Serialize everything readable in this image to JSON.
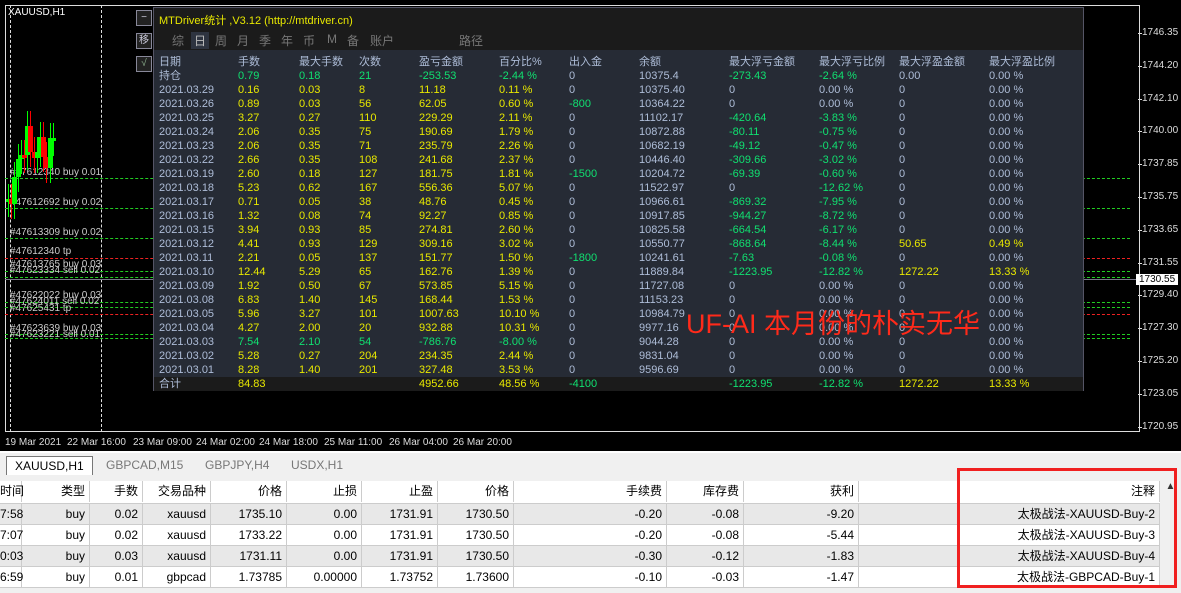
{
  "chart": {
    "symbol": "XAUUSD,H1",
    "current_price": "1730.55",
    "price_ticks": [
      "1746.35",
      "1744.20",
      "1742.10",
      "1740.00",
      "1737.85",
      "1735.75",
      "1733.65",
      "1731.55",
      "1729.40",
      "1727.30",
      "1725.20",
      "1723.05",
      "1720.95"
    ],
    "time_ticks": [
      "19 Mar 2021",
      "22 Mar 16:00",
      "23 Mar 09:00",
      "24 Mar 02:00",
      "24 Mar 18:00",
      "25 Mar 11:00",
      "26 Mar 04:00",
      "26 Mar 20:00"
    ],
    "orders": [
      "#47612340 buy 0.01",
      "#47612692 buy 0.02",
      "#47613309 buy 0.02",
      "#47612340 tp",
      "#47613765 buy 0.03",
      "#47623334 sell 0.02",
      "#47622022 buy 0.03",
      "#47624011 sell 0.02",
      "#47625431 tp",
      "#47623639 buy 0.03",
      "#47623221 sell 0.01"
    ],
    "side_buttons": [
      "−",
      "移",
      "√"
    ]
  },
  "panel": {
    "title": "MTDriver统计 ,V3.12 (http://mtdriver.cn)",
    "tabs": [
      "综",
      "日",
      "周",
      "月",
      "季",
      "年",
      "币",
      "M",
      "备",
      "账户",
      "路径"
    ],
    "headers": [
      "日期",
      "手数",
      "最大手数",
      "次数",
      "盈亏金额",
      "百分比%",
      "出入金",
      "余额",
      "最大浮亏金额",
      "最大浮亏比例",
      "最大浮盈金额",
      "最大浮盈比例"
    ],
    "rows": [
      [
        "持仓",
        "0.79",
        "0.18",
        "21",
        "-253.53",
        "-2.44 %",
        "0",
        "10375.4",
        "-273.43",
        "-2.64 %",
        "0.00",
        "0.00 %"
      ],
      [
        "2021.03.29",
        "0.16",
        "0.03",
        "8",
        "11.18",
        "0.11 %",
        "0",
        "10375.40",
        "0",
        "0.00 %",
        "0",
        "0.00 %"
      ],
      [
        "2021.03.26",
        "0.89",
        "0.03",
        "56",
        "62.05",
        "0.60 %",
        "-800",
        "10364.22",
        "0",
        "0.00 %",
        "0",
        "0.00 %"
      ],
      [
        "2021.03.25",
        "3.27",
        "0.27",
        "110",
        "229.29",
        "2.11 %",
        "0",
        "11102.17",
        "-420.64",
        "-3.83 %",
        "0",
        "0.00 %"
      ],
      [
        "2021.03.24",
        "2.06",
        "0.35",
        "75",
        "190.69",
        "1.79 %",
        "0",
        "10872.88",
        "-80.11",
        "-0.75 %",
        "0",
        "0.00 %"
      ],
      [
        "2021.03.23",
        "2.06",
        "0.35",
        "71",
        "235.79",
        "2.26 %",
        "0",
        "10682.19",
        "-49.12",
        "-0.47 %",
        "0",
        "0.00 %"
      ],
      [
        "2021.03.22",
        "2.66",
        "0.35",
        "108",
        "241.68",
        "2.37 %",
        "0",
        "10446.40",
        "-309.66",
        "-3.02 %",
        "0",
        "0.00 %"
      ],
      [
        "2021.03.19",
        "2.60",
        "0.18",
        "127",
        "181.75",
        "1.81 %",
        "-1500",
        "10204.72",
        "-69.39",
        "-0.60 %",
        "0",
        "0.00 %"
      ],
      [
        "2021.03.18",
        "5.23",
        "0.62",
        "167",
        "556.36",
        "5.07 %",
        "0",
        "11522.97",
        "0",
        "-12.62 %",
        "0",
        "0.00 %"
      ],
      [
        "2021.03.17",
        "0.71",
        "0.05",
        "38",
        "48.76",
        "0.45 %",
        "0",
        "10966.61",
        "-869.32",
        "-7.95 %",
        "0",
        "0.00 %"
      ],
      [
        "2021.03.16",
        "1.32",
        "0.08",
        "74",
        "92.27",
        "0.85 %",
        "0",
        "10917.85",
        "-944.27",
        "-8.72 %",
        "0",
        "0.00 %"
      ],
      [
        "2021.03.15",
        "3.94",
        "0.93",
        "85",
        "274.81",
        "2.60 %",
        "0",
        "10825.58",
        "-664.54",
        "-6.17 %",
        "0",
        "0.00 %"
      ],
      [
        "2021.03.12",
        "4.41",
        "0.93",
        "129",
        "309.16",
        "3.02 %",
        "0",
        "10550.77",
        "-868.64",
        "-8.44 %",
        "50.65",
        "0.49 %"
      ],
      [
        "2021.03.11",
        "2.21",
        "0.05",
        "137",
        "151.77",
        "1.50 %",
        "-1800",
        "10241.61",
        "-7.63",
        "-0.08 %",
        "0",
        "0.00 %"
      ],
      [
        "2021.03.10",
        "12.44",
        "5.29",
        "65",
        "162.76",
        "1.39 %",
        "0",
        "11889.84",
        "-1223.95",
        "-12.82 %",
        "1272.22",
        "13.33 %"
      ],
      [
        "2021.03.09",
        "1.92",
        "0.50",
        "67",
        "573.85",
        "5.15 %",
        "0",
        "11727.08",
        "0",
        "0.00 %",
        "0",
        "0.00 %"
      ],
      [
        "2021.03.08",
        "6.83",
        "1.40",
        "145",
        "168.44",
        "1.53 %",
        "0",
        "11153.23",
        "0",
        "0.00 %",
        "0",
        "0.00 %"
      ],
      [
        "2021.03.05",
        "5.96",
        "3.27",
        "101",
        "1007.63",
        "10.10 %",
        "0",
        "10984.79",
        "0",
        "0.00 %",
        "0",
        "0.00 %"
      ],
      [
        "2021.03.04",
        "4.27",
        "2.00",
        "20",
        "932.88",
        "10.31 %",
        "0",
        "9977.16",
        "0",
        "0.00 %",
        "0",
        "0.00 %"
      ],
      [
        "2021.03.03",
        "7.54",
        "2.10",
        "54",
        "-786.76",
        "-8.00 %",
        "0",
        "9044.28",
        "0",
        "0.00 %",
        "0",
        "0.00 %"
      ],
      [
        "2021.03.02",
        "5.28",
        "0.27",
        "204",
        "234.35",
        "2.44 %",
        "0",
        "9831.04",
        "0",
        "0.00 %",
        "0",
        "0.00 %"
      ],
      [
        "2021.03.01",
        "8.28",
        "1.40",
        "201",
        "327.48",
        "3.53 %",
        "0",
        "9596.69",
        "0",
        "0.00 %",
        "0",
        "0.00 %"
      ]
    ],
    "total": [
      "合计",
      "84.83",
      "",
      "",
      "4952.66",
      "48.56 %",
      "-4100",
      "",
      "-1223.95",
      "-12.82 %",
      "1272.22",
      "13.33 %"
    ],
    "watermark": "UF-AI 本月份的朴实无华"
  },
  "bottom": {
    "tabs": [
      "XAUUSD,H1",
      "GBPCAD,M15",
      "GBPJPY,H4",
      "USDX,H1"
    ],
    "headers": [
      "时间",
      "类型",
      "手数",
      "交易品种",
      "价格",
      "止损",
      "止盈",
      "价格",
      "手续费",
      "库存费",
      "获利",
      "",
      "注释"
    ],
    "rows": [
      [
        "7:58",
        "buy",
        "0.02",
        "xauusd",
        "1735.10",
        "0.00",
        "1731.91",
        "1730.50",
        "-0.20",
        "-0.08",
        "-9.20",
        "",
        "太极战法-XAUUSD-Buy-2"
      ],
      [
        "7:07",
        "buy",
        "0.02",
        "xauusd",
        "1733.22",
        "0.00",
        "1731.91",
        "1730.50",
        "-0.20",
        "-0.08",
        "-5.44",
        "",
        "太极战法-XAUUSD-Buy-3"
      ],
      [
        "0:03",
        "buy",
        "0.03",
        "xauusd",
        "1731.11",
        "0.00",
        "1731.91",
        "1730.50",
        "-0.30",
        "-0.12",
        "-1.83",
        "",
        "太极战法-XAUUSD-Buy-4"
      ],
      [
        "6:59",
        "buy",
        "0.01",
        "gbpcad",
        "1.73785",
        "0.00000",
        "1.73752",
        "1.73600",
        "-0.10",
        "-0.03",
        "-1.47",
        "",
        "太极战法-GBPCAD-Buy-1"
      ]
    ]
  },
  "colors": {
    "yellow": "#e8e800",
    "green": "#10e070",
    "gray": "#aebdd8",
    "highlight": "#f02020"
  }
}
